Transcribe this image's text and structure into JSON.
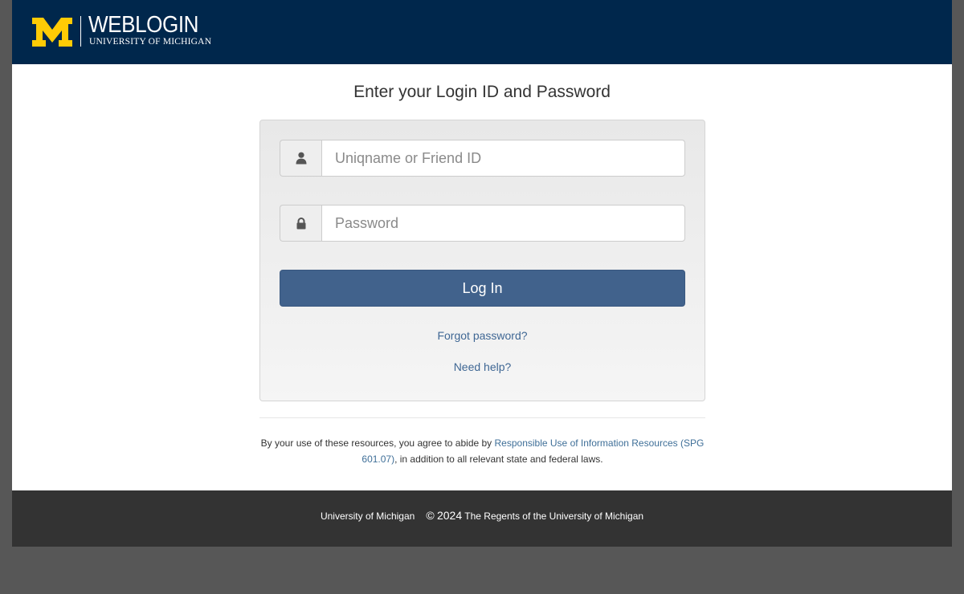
{
  "header": {
    "brand_title": "WEBLOGIN",
    "brand_subtitle": "UNIVERSITY OF MICHIGAN",
    "logo_letter": "M",
    "logo_color": "#ffcb05",
    "background_color": "#00274c"
  },
  "main": {
    "heading": "Enter your Login ID and Password",
    "username": {
      "placeholder": "Uniqname or Friend ID",
      "value": "",
      "icon": "user-icon"
    },
    "password": {
      "placeholder": "Password",
      "value": "",
      "icon": "lock-icon"
    },
    "login_button": "Log In",
    "login_button_color": "#41628c",
    "forgot_password_link": "Forgot password?",
    "need_help_link": "Need help?"
  },
  "disclaimer": {
    "prefix": "By your use of these resources, you agree to abide by ",
    "link_text": "Responsible Use of Information Resources (SPG 601.07)",
    "suffix": ", in addition to all relevant state and federal laws."
  },
  "footer": {
    "institution": "University of Michigan",
    "copyright_symbol": "©",
    "year": "2024",
    "holder": "The Regents of the University of Michigan"
  }
}
